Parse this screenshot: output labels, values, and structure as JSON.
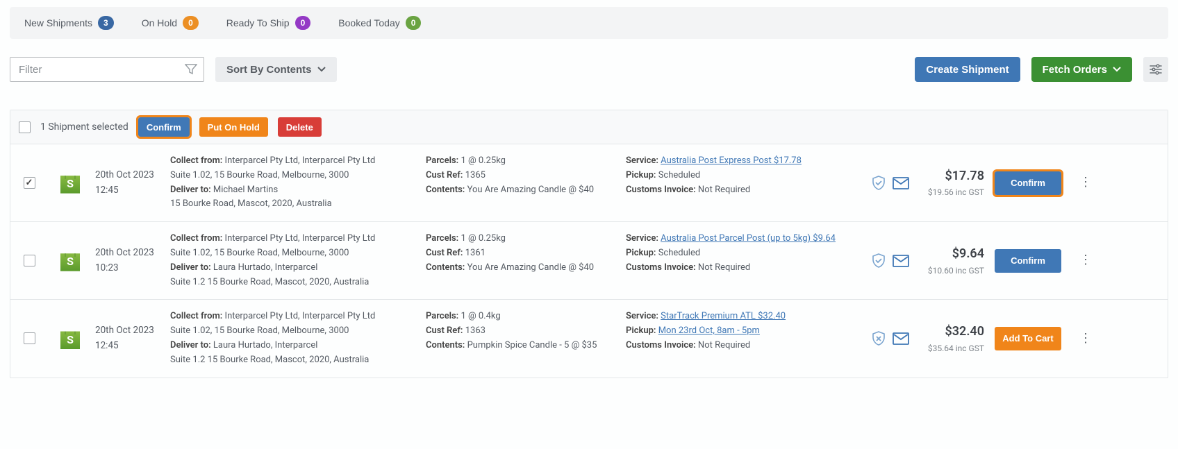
{
  "tabs": [
    {
      "label": "New Shipments",
      "count": "3",
      "badge_class": "badge-blue"
    },
    {
      "label": "On Hold",
      "count": "0",
      "badge_class": "badge-orange"
    },
    {
      "label": "Ready To Ship",
      "count": "0",
      "badge_class": "badge-purple"
    },
    {
      "label": "Booked Today",
      "count": "0",
      "badge_class": "badge-green"
    }
  ],
  "toolbar": {
    "filter_placeholder": "Filter",
    "sort_label": "Sort By Contents",
    "create_shipment_label": "Create Shipment",
    "fetch_orders_label": "Fetch Orders"
  },
  "select_bar": {
    "text": "1 Shipment selected",
    "confirm_label": "Confirm",
    "hold_label": "Put On Hold",
    "delete_label": "Delete"
  },
  "labels": {
    "collect_from": "Collect from:",
    "deliver_to": "Deliver to:",
    "parcels": "Parcels:",
    "cust_ref": "Cust Ref:",
    "contents": "Contents:",
    "service": "Service:",
    "pickup": "Pickup:",
    "customs": "Customs Invoice:"
  },
  "rows": [
    {
      "checked": true,
      "date": "20th Oct 2023",
      "time": "12:45",
      "collect_from": "Interparcel Pty Ltd, Interparcel Pty Ltd",
      "collect_addr": "Suite 1.02, 15 Bourke Road, Melbourne, 3000",
      "deliver_to": "Michael Martins",
      "deliver_addr": "15 Bourke Road, Mascot, 2020, Australia",
      "parcels": "1 @ 0.25kg",
      "cust_ref": "1365",
      "contents": "You Are Amazing Candle @ $40",
      "service": "Australia Post Express Post $17.78",
      "pickup": "Scheduled",
      "pickup_link": false,
      "customs": "Not Required",
      "shield_ok": true,
      "price": "$17.78",
      "price_sub": "$19.56 inc GST",
      "action_label": "Confirm",
      "action_style": "primary",
      "highlight_action": true
    },
    {
      "checked": false,
      "date": "20th Oct 2023",
      "time": "10:23",
      "collect_from": "Interparcel Pty Ltd, Interparcel Pty Ltd",
      "collect_addr": "Suite 1.02, 15 Bourke Road, Melbourne, 3000",
      "deliver_to": "Laura Hurtado, Interparcel",
      "deliver_addr": "Suite 1.2 15 Bourke Road, Mascot, 2020, Australia",
      "parcels": "1 @ 0.25kg",
      "cust_ref": "1361",
      "contents": "You Are Amazing Candle @ $40",
      "service": "Australia Post Parcel Post (up to 5kg) $9.64",
      "pickup": "Scheduled",
      "pickup_link": false,
      "customs": "Not Required",
      "shield_ok": true,
      "price": "$9.64",
      "price_sub": "$10.60 inc GST",
      "action_label": "Confirm",
      "action_style": "primary",
      "highlight_action": false
    },
    {
      "checked": false,
      "date": "20th Oct 2023",
      "time": "12:45",
      "collect_from": "Interparcel Pty Ltd, Interparcel Pty Ltd",
      "collect_addr": "Suite 1.02, 15 Bourke Road, Melbourne, 3000",
      "deliver_to": "Laura Hurtado, Interparcel",
      "deliver_addr": "Suite 1.2 15 Bourke Road, Mascot, 2020, Australia",
      "parcels": "1 @ 0.4kg",
      "cust_ref": "1363",
      "contents": "Pumpkin Spice Candle - 5 @ $35",
      "service": "StarTrack Premium ATL $32.40",
      "pickup": "Mon 23rd Oct, 8am - 5pm",
      "pickup_link": true,
      "customs": "Not Required",
      "shield_ok": false,
      "price": "$32.40",
      "price_sub": "$35.64 inc GST",
      "action_label": "Add To Cart",
      "action_style": "orange",
      "highlight_action": false
    }
  ]
}
